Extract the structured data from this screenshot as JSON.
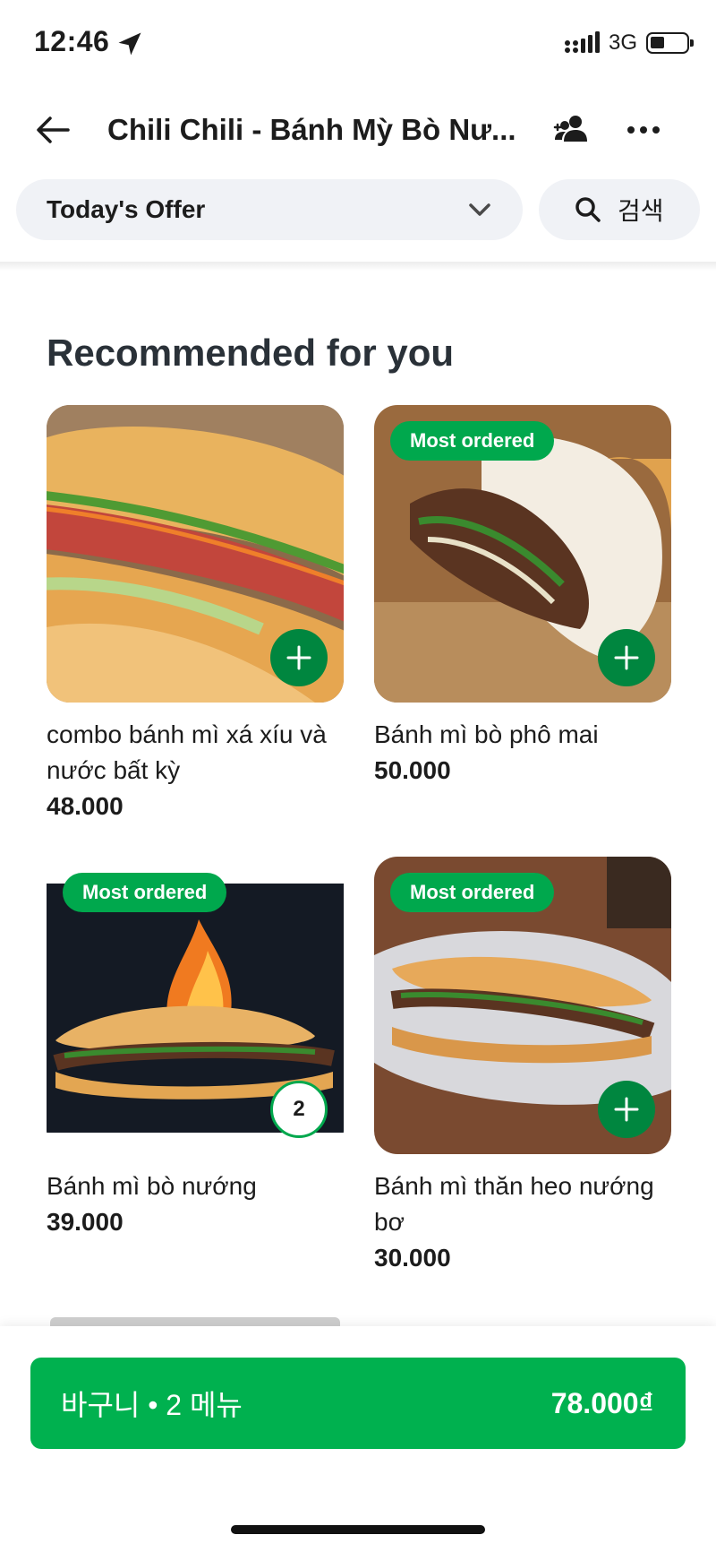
{
  "status_bar": {
    "time": "12:46",
    "network": "3G"
  },
  "header": {
    "title": "Chili Chili - Bánh Mỳ Bò Nư..."
  },
  "filter": {
    "category": "Today's Offer",
    "search_label": "검색"
  },
  "section": {
    "title": "Recommended for you"
  },
  "items": [
    {
      "name": "combo bánh mì xá xíu và nước bất kỳ",
      "price": "48.000",
      "badge": "",
      "in_cart": ""
    },
    {
      "name": "Bánh mì bò phô mai",
      "price": "50.000",
      "badge": "Most ordered",
      "in_cart": ""
    },
    {
      "name": "Bánh mì bò nướng",
      "price": "39.000",
      "badge": "Most ordered",
      "in_cart": "2"
    },
    {
      "name": "Bánh mì thăn heo nướng bơ",
      "price": "30.000",
      "badge": "Most ordered",
      "in_cart": ""
    }
  ],
  "basket": {
    "label": "바구니 • 2 메뉴",
    "total": "78.000₫"
  },
  "colors": {
    "brand_green": "#00b14f",
    "badge_green": "#00a84d",
    "add_button_green": "#00863f"
  }
}
